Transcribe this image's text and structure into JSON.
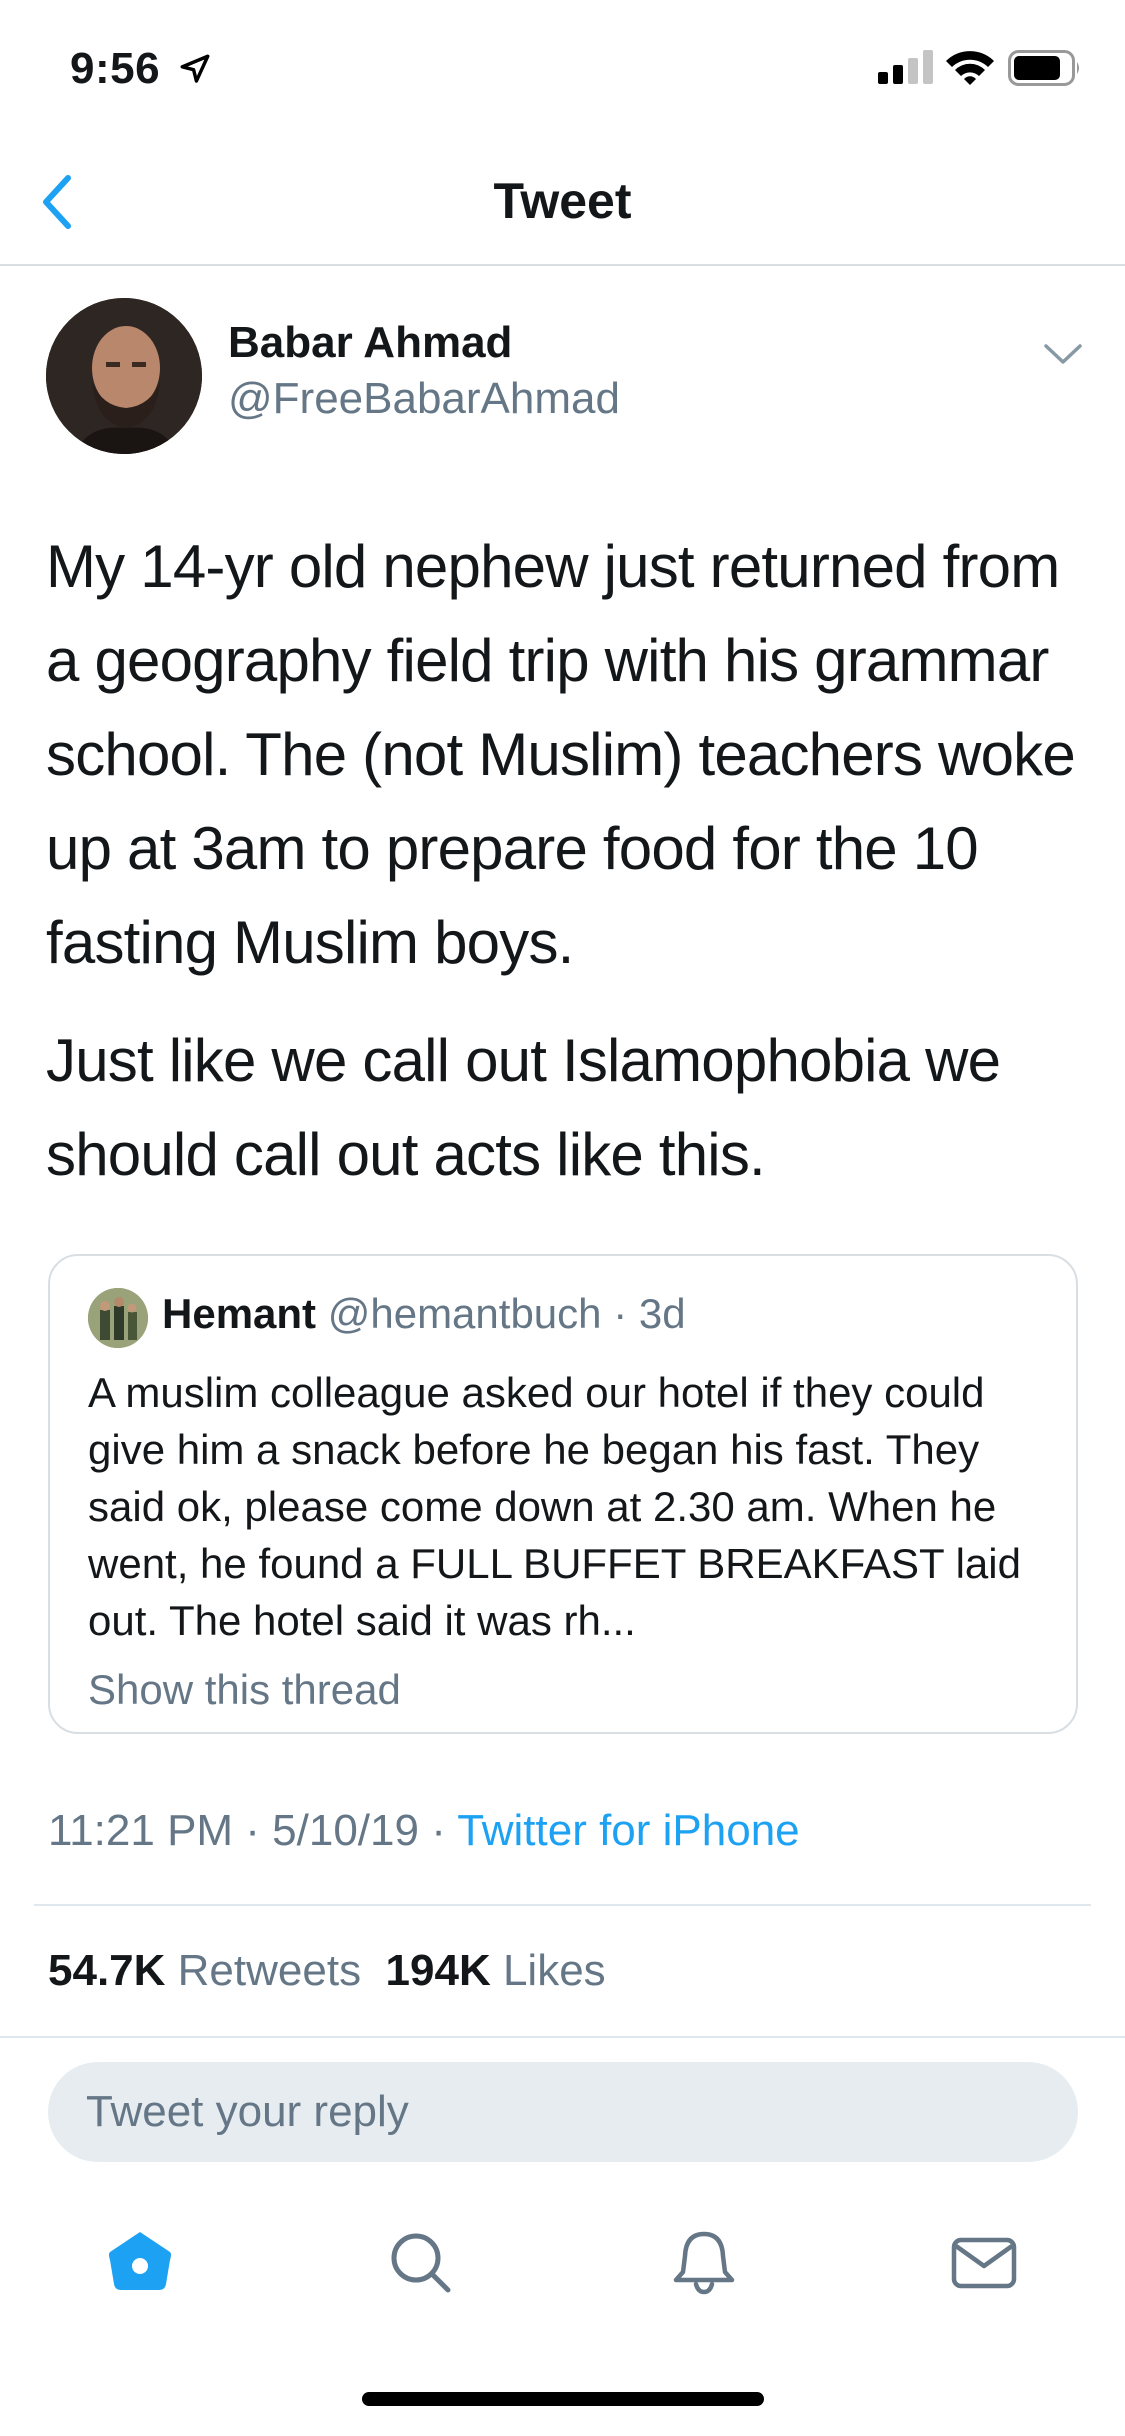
{
  "status_bar": {
    "time": "9:56",
    "icons": [
      "location-arrow-icon",
      "cellular-signal-icon",
      "wifi-icon",
      "battery-icon"
    ]
  },
  "nav": {
    "title": "Tweet",
    "back_icon": "chevron-left-icon"
  },
  "tweet": {
    "author_name": "Babar Ahmad",
    "author_handle": "@FreeBabarAhmad",
    "paragraphs": [
      "My 14-yr old nephew just returned from a geography field trip with his grammar school. The (not Muslim) teachers woke up at 3am to prepare food for the 10 fasting Muslim boys.",
      "Just like we call out Islamophobia we should call out acts like this."
    ],
    "quote": {
      "name": "Hemant",
      "meta": "@hemantbuch · 3d",
      "text": "A muslim colleague asked our hotel if they could give him a snack before he began his fast. They said ok, please come down at 2.30 am. When he went, he found a FULL BUFFET BREAKFAST laid out. The hotel said it was rh...",
      "show_thread": "Show this thread"
    },
    "timestamp": "11:21 PM · 5/10/19 · ",
    "source": "Twitter for iPhone",
    "retweets_count": "54.7K",
    "retweets_label": "Retweets",
    "likes_count": "194K",
    "likes_label": "Likes"
  },
  "reply": {
    "placeholder": "Tweet your reply"
  },
  "tab_bar": {
    "items": [
      "home-icon",
      "search-icon",
      "bell-icon",
      "mail-icon"
    ],
    "active": "home-icon"
  },
  "colors": {
    "accent": "#1da1f2",
    "secondary_text": "#657786",
    "border": "#d9dee3",
    "reply_bg": "#e6ecf0"
  }
}
